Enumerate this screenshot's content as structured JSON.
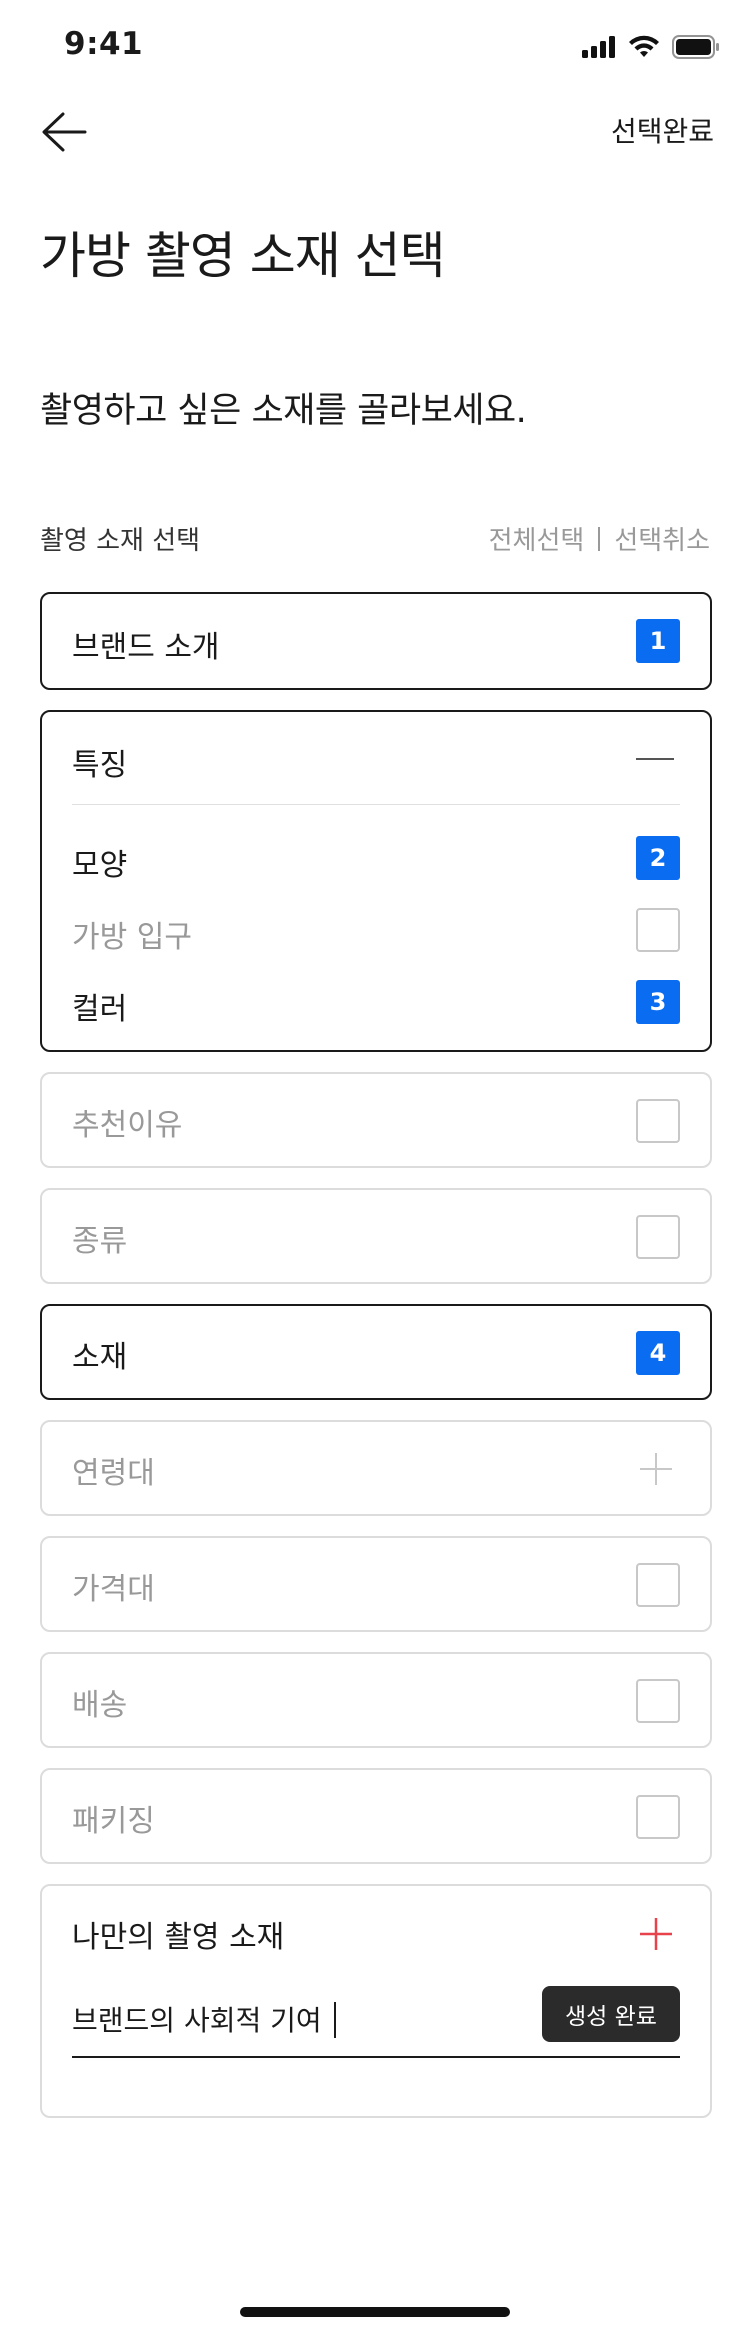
{
  "status_bar": {
    "time": "9:41"
  },
  "header": {
    "done_label": "선택완료"
  },
  "page_title": "가방 촬영 소재 선택",
  "subtitle": "촬영하고 싶은 소재를 골라보세요.",
  "section": {
    "label": "촬영 소재 선택",
    "select_all": "전체선택",
    "deselect_all": "선택취소"
  },
  "items": [
    {
      "label": "브랜드 소개",
      "selected": true,
      "order": "1"
    },
    {
      "label": "특징",
      "expanded": true,
      "children": [
        {
          "label": "모양",
          "selected": true,
          "order": "2"
        },
        {
          "label": "가방 입구",
          "selected": false
        },
        {
          "label": "컬러",
          "selected": true,
          "order": "3"
        }
      ]
    },
    {
      "label": "추천이유",
      "selected": false
    },
    {
      "label": "종류",
      "selected": false
    },
    {
      "label": "소재",
      "selected": true,
      "order": "4"
    },
    {
      "label": "연령대",
      "selected": false,
      "expandable": true
    },
    {
      "label": "가격대",
      "selected": false
    },
    {
      "label": "배송",
      "selected": false
    },
    {
      "label": "패키징",
      "selected": false
    }
  ],
  "custom": {
    "label": "나만의 촬영 소재",
    "input_value": "브랜드의 사회적 기여",
    "create_label": "생성 완료"
  },
  "colors": {
    "accent": "#0a6cf0",
    "add_icon": "#e8434d",
    "border_active": "#1a1a1a",
    "border_idle": "#dcdcdc"
  }
}
